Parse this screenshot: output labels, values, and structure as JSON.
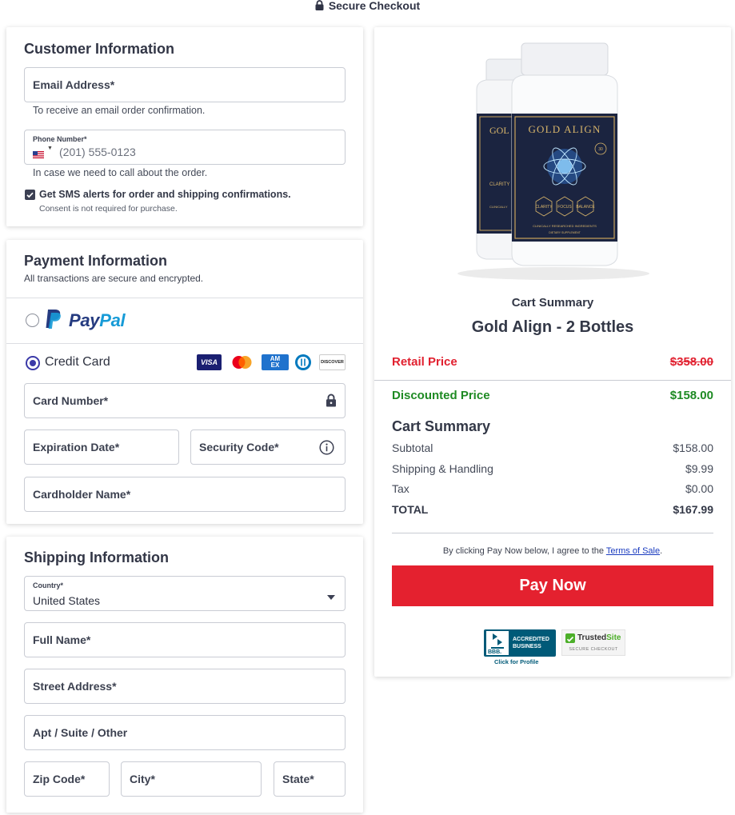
{
  "header": {
    "title": "Secure Checkout"
  },
  "customer": {
    "title": "Customer Information",
    "email_label": "Email Address*",
    "email_help": "To receive an email order confirmation.",
    "phone_label": "Phone Number*",
    "phone_placeholder": "(201) 555-0123",
    "phone_help": "In case we need to call about the order.",
    "sms_label": "Get SMS alerts for order and shipping confirmations.",
    "sms_consent": "Consent is not required for purchase.",
    "sms_checked": true
  },
  "payment": {
    "title": "Payment Information",
    "subtitle": "All transactions are secure and encrypted.",
    "paypal_label_a": "Pay",
    "paypal_label_b": "Pal",
    "credit_label": "Credit Card",
    "card_logos": {
      "visa": "VISA",
      "amex_a": "AM",
      "amex_b": "EX",
      "discover": "DISCOVER"
    },
    "card_number": "Card Number*",
    "expiration": "Expiration Date*",
    "security_code": "Security Code*",
    "cardholder": "Cardholder Name*"
  },
  "shipping": {
    "title": "Shipping Information",
    "country_label": "Country*",
    "country_value": "United States",
    "full_name": "Full Name*",
    "street": "Street Address*",
    "apt": "Apt / Suite / Other",
    "zip": "Zip Code*",
    "city": "City*",
    "state": "State*"
  },
  "product": {
    "brand": "GOLD ALIGN",
    "brand_back": "GOL",
    "count": "30",
    "hex_labels": [
      "CLARITY",
      "FOCUS",
      "BALANCE"
    ],
    "hex_back": "CLARITY",
    "tagline": "CLINICALLY RESEARCHED INGREDIENTS",
    "subline": "DIETARY SUPPLEMENT",
    "tagline_back": "CLINICALLY"
  },
  "cart": {
    "heading": "Cart Summary",
    "product_name": "Gold Align - 2 Bottles",
    "retail_label": "Retail Price",
    "retail_value": "$358.00",
    "discount_label": "Discounted Price",
    "discount_value": "$158.00",
    "summary_title": "Cart Summary",
    "rows": [
      {
        "label": "Subtotal",
        "value": "$158.00"
      },
      {
        "label": "Shipping & Handling",
        "value": "$9.99"
      },
      {
        "label": "Tax",
        "value": "$0.00"
      }
    ],
    "total_label": "TOTAL",
    "total_value": "$167.99",
    "terms_prefix": "By clicking Pay Now below, I agree to the ",
    "terms_link": "Terms of Sale",
    "terms_suffix": ".",
    "pay_button": "Pay Now"
  },
  "badges": {
    "bbb_line1": "ACCREDITED",
    "bbb_line2": "BUSINESS",
    "bbb_mark": "BBB.",
    "bbb_caption": "Click for Profile",
    "trusted_a": "Trusted",
    "trusted_b": "Site",
    "trusted_sub": "SECURE CHECKOUT"
  },
  "colors": {
    "accent": "#3b3aa8",
    "retail_red": "#e1202f",
    "discount_green": "#1e8a23",
    "pay_button": "#e4212f"
  }
}
